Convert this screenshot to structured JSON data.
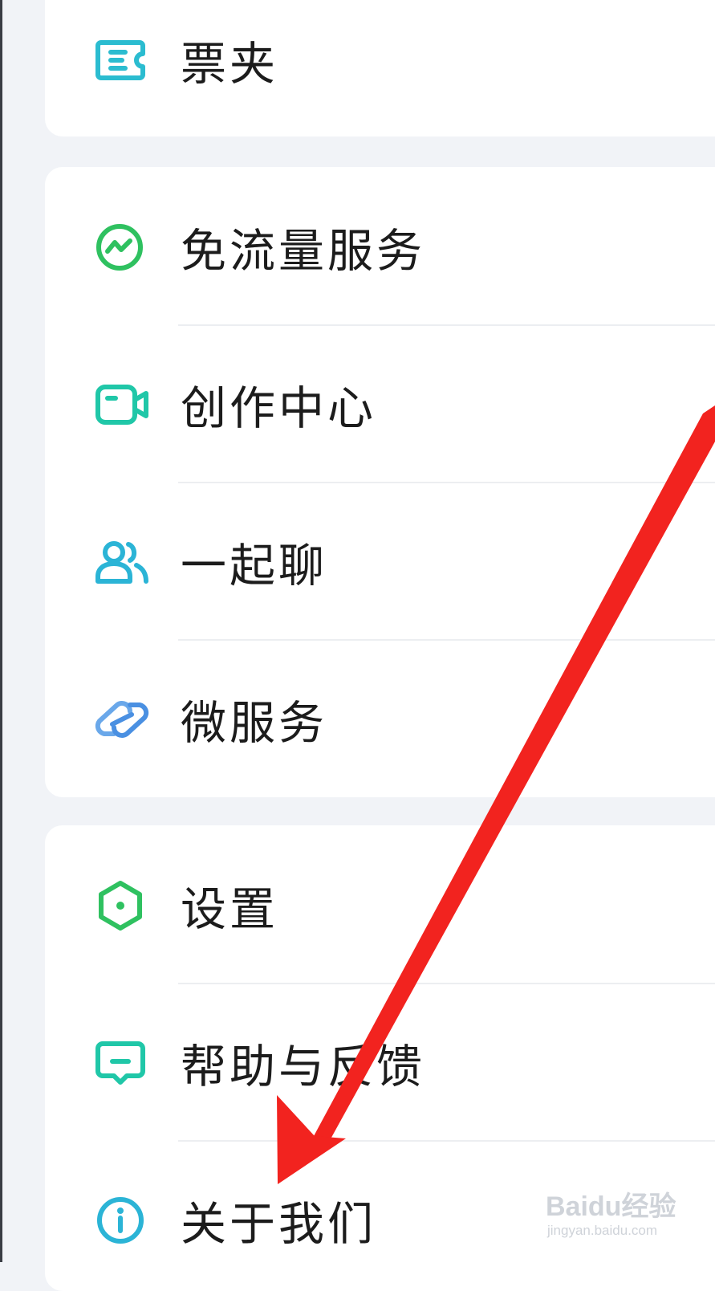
{
  "menu": {
    "group1": {
      "items": [
        {
          "label": "票夹",
          "icon": "ticket-folder-icon",
          "color": "#2bbcd0"
        }
      ]
    },
    "group2": {
      "items": [
        {
          "label": "免流量服务",
          "icon": "free-data-icon",
          "color": "#2fc160"
        },
        {
          "label": "创作中心",
          "icon": "video-camera-icon",
          "color": "#20c7a8"
        },
        {
          "label": "一起聊",
          "icon": "people-chat-icon",
          "color": "#2bb4d6"
        },
        {
          "label": "微服务",
          "icon": "link-chain-icon",
          "color": "#4a90e2"
        }
      ]
    },
    "group3": {
      "items": [
        {
          "label": "设置",
          "icon": "hexagon-settings-icon",
          "color": "#2fc160"
        },
        {
          "label": "帮助与反馈",
          "icon": "feedback-chat-icon",
          "color": "#20c7a8"
        },
        {
          "label": "关于我们",
          "icon": "info-icon",
          "color": "#2bb4d6"
        }
      ]
    }
  },
  "annotation": {
    "arrow_color": "#f2231f",
    "target": "关于我们"
  },
  "watermark": {
    "logo_text": "Baidu经验",
    "url": "jingyan.baidu.com"
  }
}
